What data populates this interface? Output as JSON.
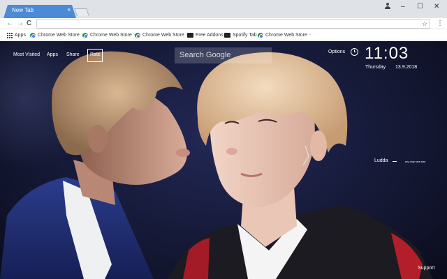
{
  "browser": {
    "tab_title": "New Tab",
    "tab_close": "×",
    "window_controls": {
      "minimize": "–",
      "maximize": "☐",
      "close": "✕"
    },
    "nav": {
      "back": "←",
      "forward": "→",
      "reload": "C"
    },
    "address": "",
    "star": "☆",
    "menu": "⋮"
  },
  "bookmarks": [
    {
      "label": "Apps",
      "icon": "apps-grid-icon"
    },
    {
      "label": "Chrome Web Store",
      "icon": "chrome-icon"
    },
    {
      "label": "Chrome Web Store",
      "icon": "chrome-icon"
    },
    {
      "label": "Chrome Web Store",
      "icon": "chrome-icon"
    },
    {
      "label": "Free Addons",
      "icon": "free-addons-icon"
    },
    {
      "label": "Spotify Tab",
      "icon": "spotify-tab-icon"
    },
    {
      "label": "Chrome Web Store",
      "icon": "chrome-icon"
    }
  ],
  "page": {
    "links": [
      "Most Visited",
      "Apps",
      "Share",
      "Rate"
    ],
    "search_placeholder": "Search Google",
    "options": "Options",
    "time": "11:03",
    "day": "Thursday",
    "date": "13.9.2018",
    "quote_author": "Ludda",
    "quote_text": "my only sea star",
    "support": "Support"
  },
  "colors": {
    "tab_active": "#4c8ad6",
    "titlebar": "#dfe3e8",
    "wallpaper_dark": "#151936"
  }
}
